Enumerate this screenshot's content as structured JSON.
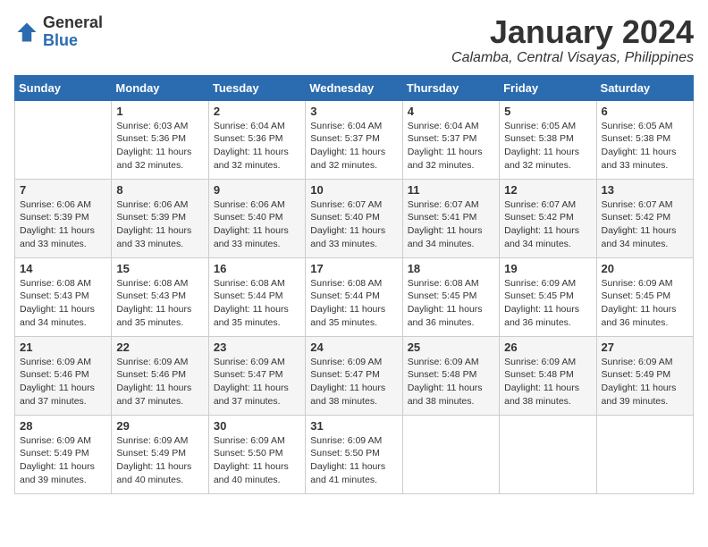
{
  "header": {
    "logo_general": "General",
    "logo_blue": "Blue",
    "title": "January 2024",
    "subtitle": "Calamba, Central Visayas, Philippines"
  },
  "weekdays": [
    "Sunday",
    "Monday",
    "Tuesday",
    "Wednesday",
    "Thursday",
    "Friday",
    "Saturday"
  ],
  "weeks": [
    [
      {
        "day": "",
        "sunrise": "",
        "sunset": "",
        "daylight": ""
      },
      {
        "day": "1",
        "sunrise": "Sunrise: 6:03 AM",
        "sunset": "Sunset: 5:36 PM",
        "daylight": "Daylight: 11 hours and 32 minutes."
      },
      {
        "day": "2",
        "sunrise": "Sunrise: 6:04 AM",
        "sunset": "Sunset: 5:36 PM",
        "daylight": "Daylight: 11 hours and 32 minutes."
      },
      {
        "day": "3",
        "sunrise": "Sunrise: 6:04 AM",
        "sunset": "Sunset: 5:37 PM",
        "daylight": "Daylight: 11 hours and 32 minutes."
      },
      {
        "day": "4",
        "sunrise": "Sunrise: 6:04 AM",
        "sunset": "Sunset: 5:37 PM",
        "daylight": "Daylight: 11 hours and 32 minutes."
      },
      {
        "day": "5",
        "sunrise": "Sunrise: 6:05 AM",
        "sunset": "Sunset: 5:38 PM",
        "daylight": "Daylight: 11 hours and 32 minutes."
      },
      {
        "day": "6",
        "sunrise": "Sunrise: 6:05 AM",
        "sunset": "Sunset: 5:38 PM",
        "daylight": "Daylight: 11 hours and 33 minutes."
      }
    ],
    [
      {
        "day": "7",
        "sunrise": "Sunrise: 6:06 AM",
        "sunset": "Sunset: 5:39 PM",
        "daylight": "Daylight: 11 hours and 33 minutes."
      },
      {
        "day": "8",
        "sunrise": "Sunrise: 6:06 AM",
        "sunset": "Sunset: 5:39 PM",
        "daylight": "Daylight: 11 hours and 33 minutes."
      },
      {
        "day": "9",
        "sunrise": "Sunrise: 6:06 AM",
        "sunset": "Sunset: 5:40 PM",
        "daylight": "Daylight: 11 hours and 33 minutes."
      },
      {
        "day": "10",
        "sunrise": "Sunrise: 6:07 AM",
        "sunset": "Sunset: 5:40 PM",
        "daylight": "Daylight: 11 hours and 33 minutes."
      },
      {
        "day": "11",
        "sunrise": "Sunrise: 6:07 AM",
        "sunset": "Sunset: 5:41 PM",
        "daylight": "Daylight: 11 hours and 34 minutes."
      },
      {
        "day": "12",
        "sunrise": "Sunrise: 6:07 AM",
        "sunset": "Sunset: 5:42 PM",
        "daylight": "Daylight: 11 hours and 34 minutes."
      },
      {
        "day": "13",
        "sunrise": "Sunrise: 6:07 AM",
        "sunset": "Sunset: 5:42 PM",
        "daylight": "Daylight: 11 hours and 34 minutes."
      }
    ],
    [
      {
        "day": "14",
        "sunrise": "Sunrise: 6:08 AM",
        "sunset": "Sunset: 5:43 PM",
        "daylight": "Daylight: 11 hours and 34 minutes."
      },
      {
        "day": "15",
        "sunrise": "Sunrise: 6:08 AM",
        "sunset": "Sunset: 5:43 PM",
        "daylight": "Daylight: 11 hours and 35 minutes."
      },
      {
        "day": "16",
        "sunrise": "Sunrise: 6:08 AM",
        "sunset": "Sunset: 5:44 PM",
        "daylight": "Daylight: 11 hours and 35 minutes."
      },
      {
        "day": "17",
        "sunrise": "Sunrise: 6:08 AM",
        "sunset": "Sunset: 5:44 PM",
        "daylight": "Daylight: 11 hours and 35 minutes."
      },
      {
        "day": "18",
        "sunrise": "Sunrise: 6:08 AM",
        "sunset": "Sunset: 5:45 PM",
        "daylight": "Daylight: 11 hours and 36 minutes."
      },
      {
        "day": "19",
        "sunrise": "Sunrise: 6:09 AM",
        "sunset": "Sunset: 5:45 PM",
        "daylight": "Daylight: 11 hours and 36 minutes."
      },
      {
        "day": "20",
        "sunrise": "Sunrise: 6:09 AM",
        "sunset": "Sunset: 5:45 PM",
        "daylight": "Daylight: 11 hours and 36 minutes."
      }
    ],
    [
      {
        "day": "21",
        "sunrise": "Sunrise: 6:09 AM",
        "sunset": "Sunset: 5:46 PM",
        "daylight": "Daylight: 11 hours and 37 minutes."
      },
      {
        "day": "22",
        "sunrise": "Sunrise: 6:09 AM",
        "sunset": "Sunset: 5:46 PM",
        "daylight": "Daylight: 11 hours and 37 minutes."
      },
      {
        "day": "23",
        "sunrise": "Sunrise: 6:09 AM",
        "sunset": "Sunset: 5:47 PM",
        "daylight": "Daylight: 11 hours and 37 minutes."
      },
      {
        "day": "24",
        "sunrise": "Sunrise: 6:09 AM",
        "sunset": "Sunset: 5:47 PM",
        "daylight": "Daylight: 11 hours and 38 minutes."
      },
      {
        "day": "25",
        "sunrise": "Sunrise: 6:09 AM",
        "sunset": "Sunset: 5:48 PM",
        "daylight": "Daylight: 11 hours and 38 minutes."
      },
      {
        "day": "26",
        "sunrise": "Sunrise: 6:09 AM",
        "sunset": "Sunset: 5:48 PM",
        "daylight": "Daylight: 11 hours and 38 minutes."
      },
      {
        "day": "27",
        "sunrise": "Sunrise: 6:09 AM",
        "sunset": "Sunset: 5:49 PM",
        "daylight": "Daylight: 11 hours and 39 minutes."
      }
    ],
    [
      {
        "day": "28",
        "sunrise": "Sunrise: 6:09 AM",
        "sunset": "Sunset: 5:49 PM",
        "daylight": "Daylight: 11 hours and 39 minutes."
      },
      {
        "day": "29",
        "sunrise": "Sunrise: 6:09 AM",
        "sunset": "Sunset: 5:49 PM",
        "daylight": "Daylight: 11 hours and 40 minutes."
      },
      {
        "day": "30",
        "sunrise": "Sunrise: 6:09 AM",
        "sunset": "Sunset: 5:50 PM",
        "daylight": "Daylight: 11 hours and 40 minutes."
      },
      {
        "day": "31",
        "sunrise": "Sunrise: 6:09 AM",
        "sunset": "Sunset: 5:50 PM",
        "daylight": "Daylight: 11 hours and 41 minutes."
      },
      {
        "day": "",
        "sunrise": "",
        "sunset": "",
        "daylight": ""
      },
      {
        "day": "",
        "sunrise": "",
        "sunset": "",
        "daylight": ""
      },
      {
        "day": "",
        "sunrise": "",
        "sunset": "",
        "daylight": ""
      }
    ]
  ]
}
